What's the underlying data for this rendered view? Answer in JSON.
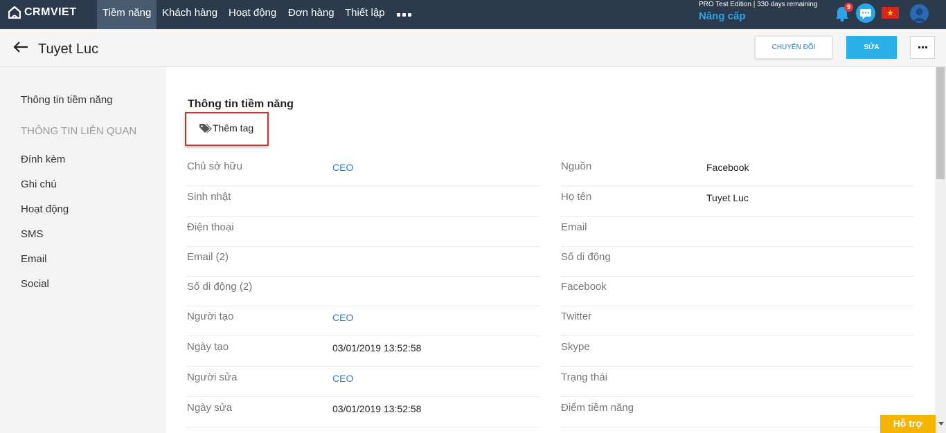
{
  "brand": {
    "name": "CRMVIET"
  },
  "nav": {
    "items": [
      {
        "label": "Tiềm năng"
      },
      {
        "label": "Khách hàng"
      },
      {
        "label": "Hoạt động"
      },
      {
        "label": "Đơn hàng"
      },
      {
        "label": "Thiết lập"
      }
    ]
  },
  "account": {
    "edition": "PRO Test Edition | 330 days remaining",
    "upgrade": "Nâng cấp",
    "notification_count": "9"
  },
  "header": {
    "title": "Tuyet Luc",
    "convert_label": "CHUYỂN ĐỔI",
    "edit_label": "SỬA"
  },
  "sidebar": {
    "main": "Thông tin tiềm năng",
    "section": "THÔNG TIN LIÊN QUAN",
    "items": [
      {
        "label": "Đính kèm"
      },
      {
        "label": "Ghi chú"
      },
      {
        "label": "Hoạt động"
      },
      {
        "label": "SMS"
      },
      {
        "label": "Email"
      },
      {
        "label": "Social"
      }
    ]
  },
  "main": {
    "section_title": "Thông tin tiềm năng",
    "add_tag": "Thêm tag",
    "left_fields": [
      {
        "label": "Chủ sở hữu",
        "value": "CEO"
      },
      {
        "label": "Sinh nhật",
        "value": ""
      },
      {
        "label": "Điện thoại",
        "value": ""
      },
      {
        "label": "Email (2)",
        "value": ""
      },
      {
        "label": "Số di động (2)",
        "value": ""
      },
      {
        "label": "Người tạo",
        "value": "CEO"
      },
      {
        "label": "Ngày tạo",
        "value": "03/01/2019 13:52:58"
      },
      {
        "label": "Người sửa",
        "value": "CEO"
      },
      {
        "label": "Ngày sửa",
        "value": "03/01/2019 13:52:58"
      }
    ],
    "right_fields": [
      {
        "label": "Nguồn",
        "value": "Facebook"
      },
      {
        "label": "Họ tên",
        "value": "Tuyet Luc"
      },
      {
        "label": "Email",
        "value": ""
      },
      {
        "label": "Số di động",
        "value": ""
      },
      {
        "label": "Facebook",
        "value": ""
      },
      {
        "label": "Twitter",
        "value": ""
      },
      {
        "label": "Skype",
        "value": ""
      },
      {
        "label": "Trạng thái",
        "value": ""
      },
      {
        "label": "Điểm tiềm năng",
        "value": ""
      }
    ]
  },
  "support": {
    "label": "Hỗ trợ"
  },
  "colors": {
    "nav_bg": "#2b3a4c",
    "accent": "#2ab0e8",
    "link": "#2b7bc8",
    "highlight_border": "#c0392b",
    "help_bg": "#f5b400"
  },
  "icons": [
    "logo-icon",
    "more-icon",
    "bell-icon",
    "chat-icon",
    "flag-vn-icon",
    "user-avatar-icon",
    "back-arrow-icon",
    "tag-icon",
    "scroll-down-icon"
  ]
}
